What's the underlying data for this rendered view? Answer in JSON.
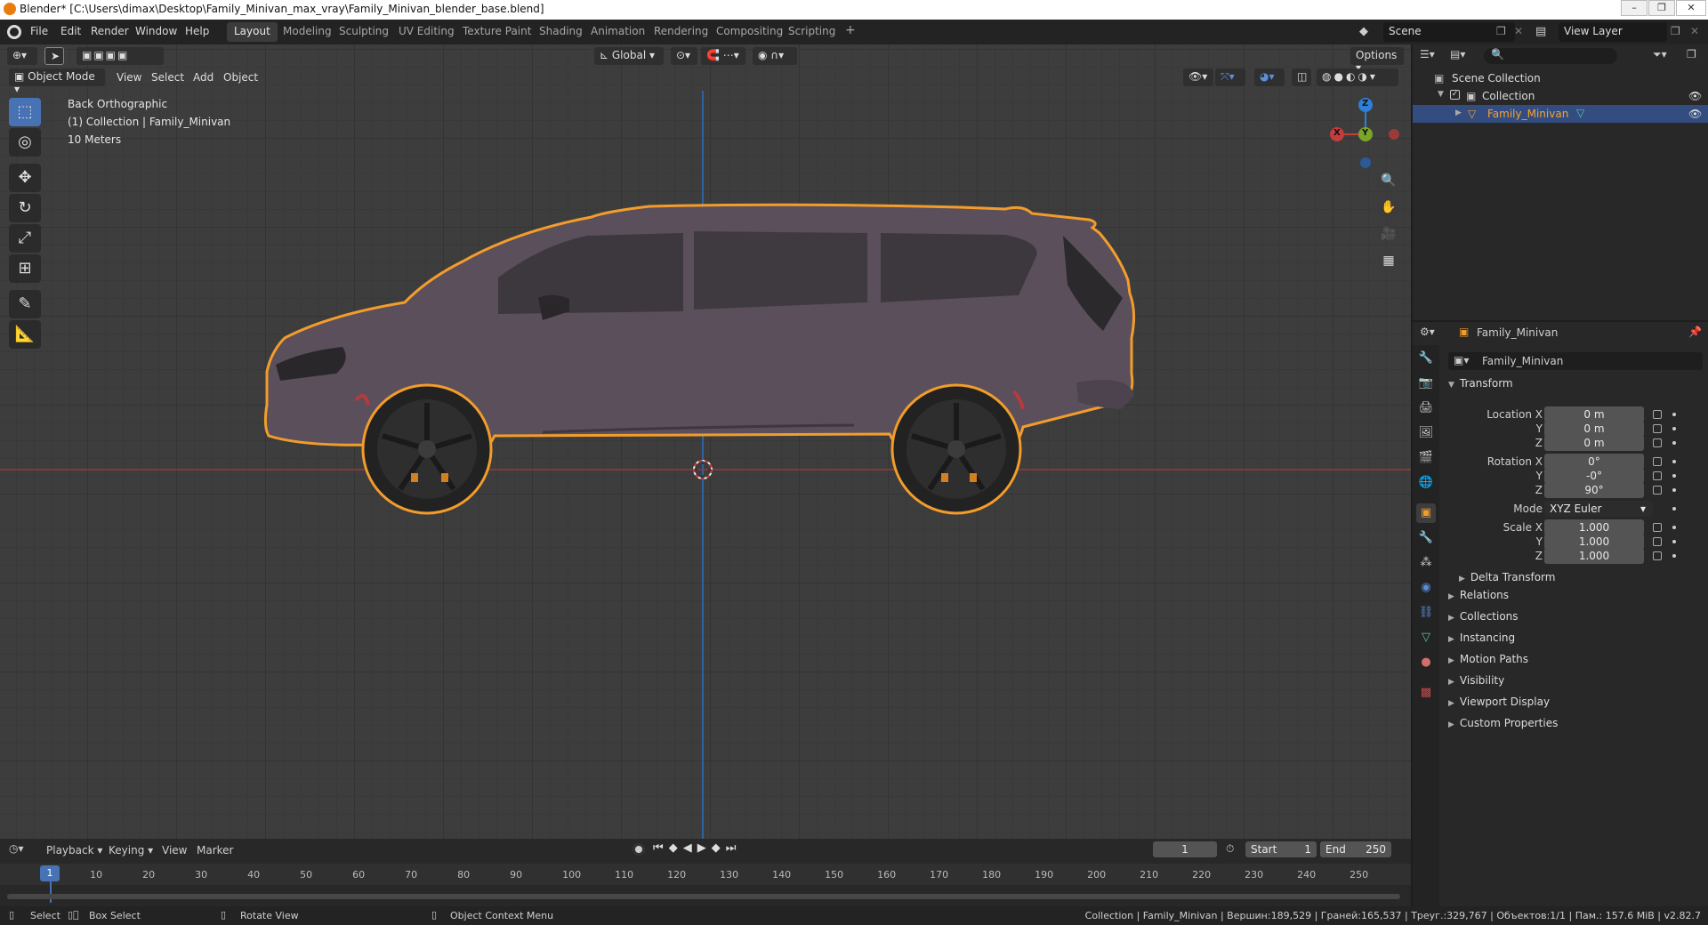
{
  "window": {
    "title": "Blender* [C:\\Users\\dimax\\Desktop\\Family_Minivan_max_vray\\Family_Minivan_blender_base.blend]",
    "controls": [
      "–",
      "❐",
      "✕"
    ]
  },
  "menu": [
    "File",
    "Edit",
    "Render",
    "Window",
    "Help"
  ],
  "workspaces": [
    "Layout",
    "Modeling",
    "Sculpting",
    "UV Editing",
    "Texture Paint",
    "Shading",
    "Animation",
    "Rendering",
    "Compositing",
    "Scripting"
  ],
  "workspace_add": "+",
  "scene": {
    "name": "Scene",
    "view_layer": "View Layer"
  },
  "viewport": {
    "mode": "Object Mode",
    "menus": [
      "View",
      "Select",
      "Add",
      "Object"
    ],
    "orientation": "Global",
    "options_label": "Options",
    "overlay": {
      "view_name": "Back Orthographic",
      "collection": "(1) Collection | Family_Minivan",
      "scale": "10 Meters"
    },
    "gizmo": {
      "z": "Z",
      "x": "X",
      "y": "Y"
    },
    "colors": {
      "selection_outline": "#f29d2b",
      "car_body": "#5b4f5c",
      "x_axis": "#c43c3c",
      "y_axis": "#7aa527",
      "z_axis": "#2d7fd8"
    }
  },
  "outliner": {
    "root": "Scene Collection",
    "collection": "Collection",
    "object": "Family_Minivan"
  },
  "properties": {
    "object_name": "Family_Minivan",
    "data_name": "Family_Minivan",
    "transform_title": "Transform",
    "location_label": "Location X",
    "location": [
      "0 m",
      "0 m",
      "0 m"
    ],
    "rotation_label": "Rotation X",
    "rotation": [
      "0°",
      "-0°",
      "90°"
    ],
    "mode_label": "Mode",
    "mode_value": "XYZ Euler",
    "scale_label": "Scale X",
    "scale": [
      "1.000",
      "1.000",
      "1.000"
    ],
    "axis_y": "Y",
    "axis_z": "Z",
    "delta_transform": "Delta Transform",
    "panels": [
      "Relations",
      "Collections",
      "Instancing",
      "Motion Paths",
      "Visibility",
      "Viewport Display",
      "Custom Properties"
    ]
  },
  "timeline": {
    "menus": [
      "Playback",
      "Keying",
      "View",
      "Marker"
    ],
    "current_frame": "1",
    "start_label": "Start",
    "start": "1",
    "end_label": "End",
    "end": "250",
    "ticks": [
      "10",
      "20",
      "30",
      "40",
      "50",
      "60",
      "70",
      "80",
      "90",
      "100",
      "110",
      "120",
      "130",
      "140",
      "150",
      "160",
      "170",
      "180",
      "190",
      "200",
      "210",
      "220",
      "230",
      "240",
      "250"
    ],
    "playhead": "1"
  },
  "statusbar": {
    "select": "Select",
    "box_select": "Box Select",
    "rotate_view": "Rotate View",
    "context_menu": "Object Context Menu",
    "stats": "Collection | Family_Minivan | Вершин:189,529 | Граней:165,537 | Треуг.:329,767 | Объектов:1/1 | Пам.: 157.6 MiB | v2.82.7"
  }
}
